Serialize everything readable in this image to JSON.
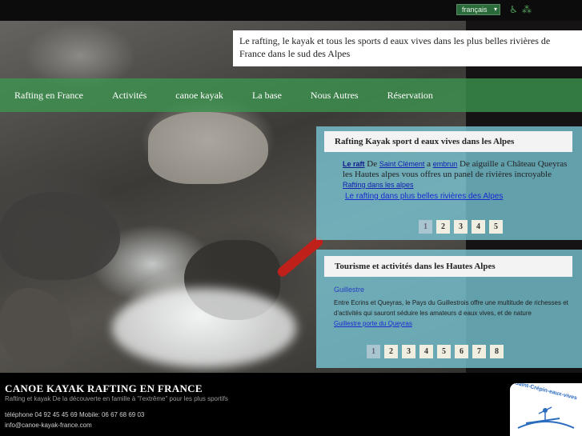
{
  "language_selector": {
    "value": "français"
  },
  "icons": {
    "accessibility": "wheelchair-icon",
    "sitemap": "sitemap-icon"
  },
  "header": {
    "tagline": "Le rafting, le kayak et tous les sports d eaux vives dans les plus belles rivières de France dans le sud des Alpes"
  },
  "nav": {
    "items": [
      {
        "label": "Rafting en France"
      },
      {
        "label": "Activités"
      },
      {
        "label": "canoe kayak"
      },
      {
        "label": "La base"
      },
      {
        "label": "Nous Autres"
      },
      {
        "label": "Réservation"
      }
    ]
  },
  "panel1": {
    "title": "Rafting Kayak sport d eaux vives dans les Alpes",
    "link_raft": "Le raft",
    "text_de": "De",
    "link_saint_clement": "Saint Clément",
    "text_a": "a",
    "link_embrun": "embrun",
    "text_body": "De aiguille a Château Queyras les Hautes alpes vous offres un panel de rivières incroyable",
    "link_rafting_alpes": "Rafting dans les alpes",
    "link_belles_rivieres": "Le rafting dans plus belles rivières des Alpes",
    "pages": [
      "1",
      "2",
      "3",
      "4",
      "5"
    ],
    "active_page": "1"
  },
  "panel2": {
    "title": "Tourisme et activités dans les Hautes Alpes",
    "place": "Guillestre",
    "text_body": "Entre Ecrins et Queyras, le Pays du Guillestrois offre une multitude de richesses et d'activités qui sauront séduire les amateurs d eaux vives, et de nature",
    "link_porte": "Guillestre porte du Queyras",
    "pages": [
      "1",
      "2",
      "3",
      "4",
      "5",
      "6",
      "7",
      "8"
    ],
    "active_page": "1"
  },
  "footer": {
    "title": "CANOE KAYAK RAFTING EN FRANCE",
    "subtitle": "Rafting et kayak De la découverte en famille à \"l'extrême\" pour les plus sportifs",
    "phone": "téléphone 04 92 45 45 69 Mobile: 06 67 68 69 03",
    "email": "info@canoe-kayak-france.com",
    "badge_text": "Saint-Crépin-eaux-vives"
  },
  "colors": {
    "nav_green": "#3c9650",
    "panel_blue": "#78c8d7",
    "link_blue": "#1a2ad0"
  }
}
